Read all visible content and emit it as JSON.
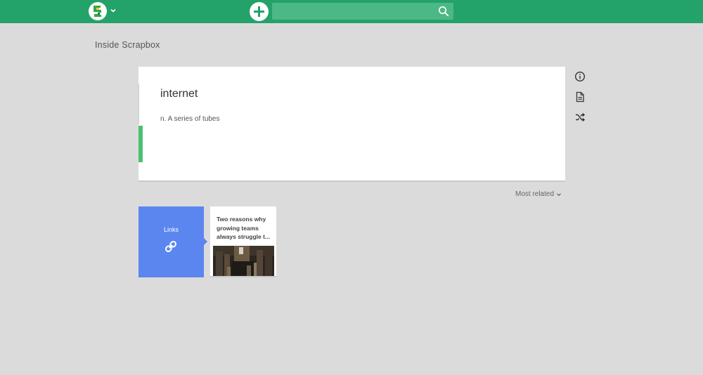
{
  "header": {
    "logo": "scrapbox-logo",
    "logo_menu_icon": "chevron-down-icon",
    "new_page_icon": "plus-icon",
    "search": {
      "placeholder": "",
      "value": "",
      "icon": "search-icon"
    },
    "colors": {
      "bar": "#23a26a",
      "search_bg": "#4cb885"
    }
  },
  "project": {
    "title": "Inside Scrapbox"
  },
  "page": {
    "title": "internet",
    "lines": [
      "n. A series of tubes"
    ],
    "marker_color": "#4cbf70"
  },
  "side_actions": [
    {
      "name": "info-icon"
    },
    {
      "name": "document-icon"
    },
    {
      "name": "shuffle-icon"
    }
  ],
  "related": {
    "sort_label": "Most related",
    "links_card": {
      "label": "Links",
      "icon": "link-icon",
      "color": "#5b86f0"
    },
    "cards": [
      {
        "title": "Two reasons why growing teams always struggle t...",
        "has_thumbnail": true
      }
    ]
  }
}
